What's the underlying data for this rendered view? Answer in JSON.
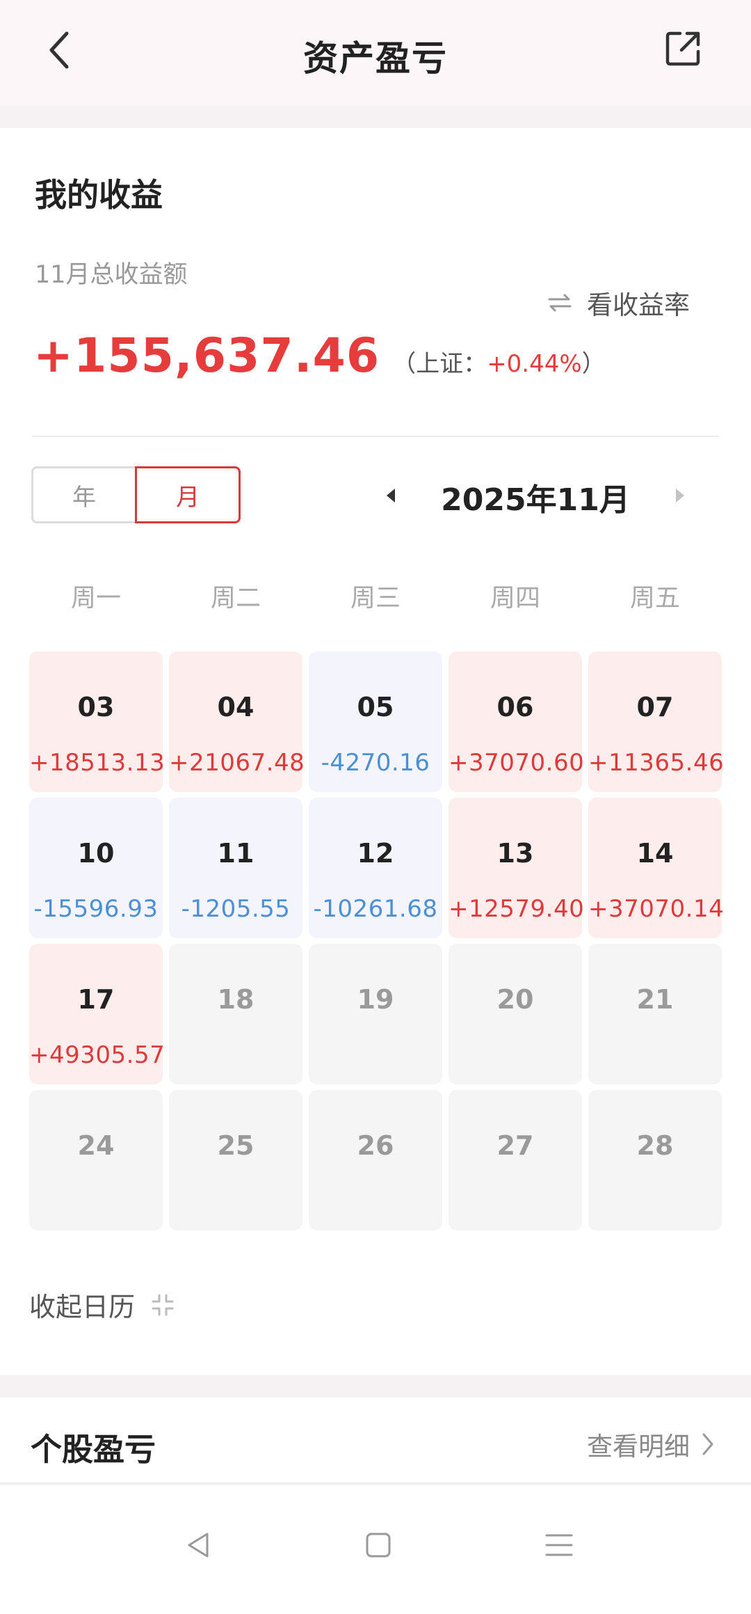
{
  "header": {
    "title": "资产盈亏",
    "back_icon": "chevron-left-icon",
    "share_icon": "share-external-icon"
  },
  "summary": {
    "section_title": "我的收益",
    "month_label": "11月总收益额",
    "toggle_label": "看收益率",
    "total": "+155,637.46",
    "benchmark_open": "（上证：",
    "benchmark_pct": "+0.44%",
    "benchmark_close": "）"
  },
  "period": {
    "year_label": "年",
    "month_label": "月",
    "selected": "月",
    "current_month": "2025年11月"
  },
  "weekdays": [
    "周一",
    "周二",
    "周三",
    "周四",
    "周五"
  ],
  "days": [
    {
      "day": "03",
      "value": "+18513.13",
      "kind": "profit"
    },
    {
      "day": "04",
      "value": "+21067.48",
      "kind": "profit"
    },
    {
      "day": "05",
      "value": "-4270.16",
      "kind": "loss"
    },
    {
      "day": "06",
      "value": "+37070.60",
      "kind": "profit"
    },
    {
      "day": "07",
      "value": "+11365.46",
      "kind": "profit"
    },
    {
      "day": "10",
      "value": "-15596.93",
      "kind": "loss"
    },
    {
      "day": "11",
      "value": "-1205.55",
      "kind": "loss"
    },
    {
      "day": "12",
      "value": "-10261.68",
      "kind": "loss"
    },
    {
      "day": "13",
      "value": "+12579.40",
      "kind": "profit"
    },
    {
      "day": "14",
      "value": "+37070.14",
      "kind": "profit"
    },
    {
      "day": "17",
      "value": "+49305.57",
      "kind": "profit"
    },
    {
      "day": "18",
      "value": "",
      "kind": "empty"
    },
    {
      "day": "19",
      "value": "",
      "kind": "empty"
    },
    {
      "day": "20",
      "value": "",
      "kind": "empty"
    },
    {
      "day": "21",
      "value": "",
      "kind": "empty"
    },
    {
      "day": "24",
      "value": "",
      "kind": "empty"
    },
    {
      "day": "25",
      "value": "",
      "kind": "empty"
    },
    {
      "day": "26",
      "value": "",
      "kind": "empty"
    },
    {
      "day": "27",
      "value": "",
      "kind": "empty"
    },
    {
      "day": "28",
      "value": "",
      "kind": "empty"
    }
  ],
  "collapse_label": "收起日历",
  "stocks": {
    "title": "个股盈亏",
    "detail_label": "查看明细"
  },
  "colors": {
    "profit": "#e0393a",
    "loss": "#4b90d6",
    "profit_bg": "#fdeeed",
    "loss_bg": "#f4f5fc",
    "accent": "#d9393a"
  }
}
